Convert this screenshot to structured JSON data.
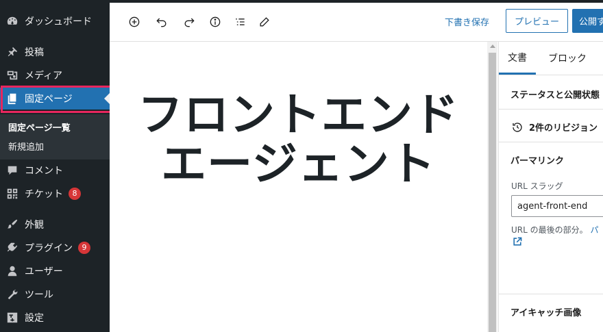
{
  "sidebar": {
    "items": [
      {
        "key": "dashboard",
        "label": "ダッシュボード",
        "icon": "dashboard-icon"
      },
      {
        "key": "posts",
        "label": "投稿",
        "icon": "pin-icon"
      },
      {
        "key": "media",
        "label": "メディア",
        "icon": "media-icon"
      },
      {
        "key": "pages",
        "label": "固定ページ",
        "icon": "pages-icon"
      },
      {
        "key": "comments",
        "label": "コメント",
        "icon": "comment-icon"
      },
      {
        "key": "tickets",
        "label": "チケット",
        "icon": "qr-icon",
        "badge": "8"
      },
      {
        "key": "appearance",
        "label": "外観",
        "icon": "brush-icon"
      },
      {
        "key": "plugins",
        "label": "プラグイン",
        "icon": "plugin-icon",
        "badge": "9"
      },
      {
        "key": "users",
        "label": "ユーザー",
        "icon": "user-icon"
      },
      {
        "key": "tools",
        "label": "ツール",
        "icon": "wrench-icon"
      },
      {
        "key": "settings",
        "label": "設定",
        "icon": "settings-icon"
      }
    ],
    "submenu": [
      "固定ページ一覧",
      "新規追加"
    ]
  },
  "header": {
    "tools": [
      "add-block-icon",
      "undo-icon",
      "redo-icon",
      "info-icon",
      "list-view-icon",
      "edit-icon"
    ],
    "draft_save": "下書き保存",
    "preview": "プレビュー",
    "publish": "公開す"
  },
  "editor": {
    "title_line1": "フロントエンド",
    "title_line2": "エージェント"
  },
  "settings": {
    "tabs": [
      "文書",
      "ブロック"
    ],
    "status_title": "ステータスと公開状態",
    "revisions": "2件のリビジョン",
    "permalink_title": "パーマリンク",
    "slug_label": "URL スラッグ",
    "slug_value": "agent-front-end",
    "help_text": "URL の最後の部分。",
    "help_link": "パ",
    "featured_image_title": "アイキャッチ画像"
  },
  "colors": {
    "sidebar_bg": "#1d2327",
    "accent": "#2271b1",
    "highlight_frame": "#e8265e",
    "badge": "#d63638"
  }
}
